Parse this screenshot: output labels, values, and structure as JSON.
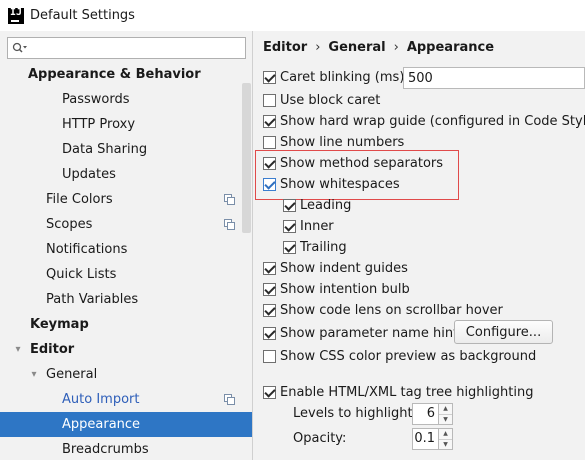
{
  "window": {
    "title": "Default Settings"
  },
  "sidebar": {
    "search": {
      "value": "",
      "placeholder": ""
    },
    "items": [
      {
        "label": "Appearance & Behavior",
        "bold": true
      },
      {
        "label": "Passwords"
      },
      {
        "label": "HTTP Proxy"
      },
      {
        "label": "Data Sharing"
      },
      {
        "label": "Updates"
      },
      {
        "label": "File Colors",
        "icon": "copy-icon"
      },
      {
        "label": "Scopes",
        "icon": "copy-icon"
      },
      {
        "label": "Notifications"
      },
      {
        "label": "Quick Lists"
      },
      {
        "label": "Path Variables"
      },
      {
        "label": "Keymap",
        "bold": true
      },
      {
        "label": "Editor",
        "bold": true,
        "expanded": true
      },
      {
        "label": "General",
        "expanded": true
      },
      {
        "label": "Auto Import",
        "link": true,
        "icon": "copy-icon"
      },
      {
        "label": "Appearance",
        "selected": true
      },
      {
        "label": "Breadcrumbs"
      }
    ]
  },
  "breadcrumb": {
    "items": [
      "Editor",
      "General",
      "Appearance"
    ],
    "separator": "›"
  },
  "options": {
    "caret_blinking": {
      "label": "Caret blinking (ms):",
      "checked": true,
      "value": "500"
    },
    "block_caret": {
      "label": "Use block caret",
      "checked": false
    },
    "hard_wrap": {
      "label": "Show hard wrap guide (configured in Code Style options)",
      "checked": true
    },
    "line_numbers": {
      "label": "Show line numbers",
      "checked": false
    },
    "method_separators": {
      "label": "Show method separators",
      "checked": true
    },
    "whitespaces": {
      "label": "Show whitespaces",
      "checked": true
    },
    "leading": {
      "label": "Leading",
      "checked": true
    },
    "inner": {
      "label": "Inner",
      "checked": true
    },
    "trailing": {
      "label": "Trailing",
      "checked": true
    },
    "indent_guides": {
      "label": "Show indent guides",
      "checked": true
    },
    "intention_bulb": {
      "label": "Show intention bulb",
      "checked": true
    },
    "code_lens": {
      "label": "Show code lens on scrollbar hover",
      "checked": true
    },
    "param_hints": {
      "label": "Show parameter name hints",
      "checked": true,
      "button": "Configure..."
    },
    "css_color": {
      "label": "Show CSS color preview as background",
      "checked": false
    },
    "tag_tree": {
      "label": "Enable HTML/XML tag tree highlighting",
      "checked": true
    },
    "levels": {
      "label": "Levels to highlight:",
      "value": "6"
    },
    "opacity": {
      "label": "Opacity:",
      "value": "0.1"
    }
  },
  "colors": {
    "selection": "#2e76c5",
    "highlight_border": "#e04a4a",
    "link": "#2f5fb9"
  }
}
